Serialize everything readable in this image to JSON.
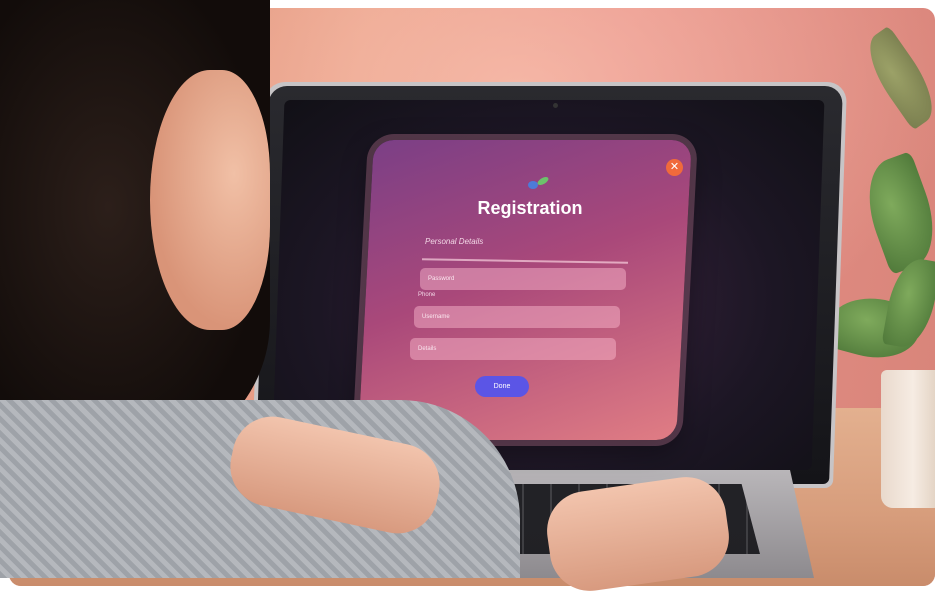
{
  "dialog": {
    "title": "Registration",
    "section_label": "Personal Details",
    "field1_placeholder": "Password",
    "field_label": "Phone",
    "field2_placeholder": "Username",
    "field3_placeholder": "Details",
    "submit_label": "Done",
    "close_icon": "✕"
  },
  "colors": {
    "dialog_gradient_start": "#7b3f86",
    "dialog_gradient_end": "#e07d84",
    "submit_button": "#5b55e6",
    "close_button": "#f06a3b"
  }
}
